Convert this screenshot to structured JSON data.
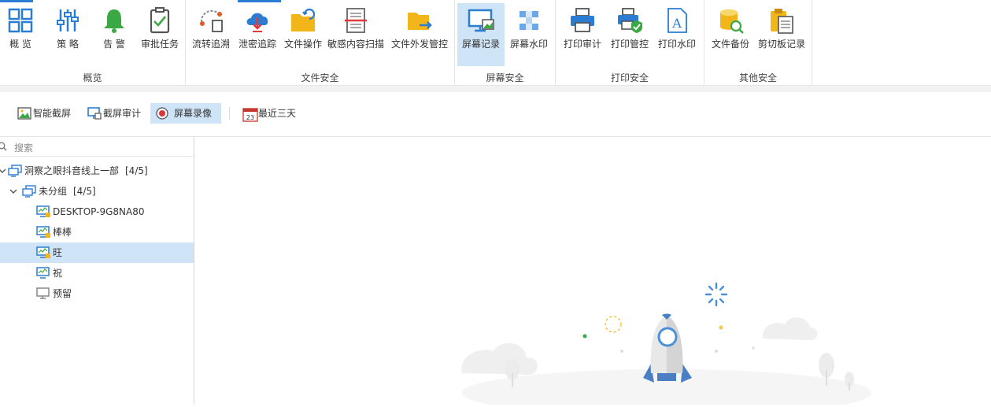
{
  "ribbon": {
    "groups": [
      {
        "label": "概览",
        "items": [
          {
            "label": "概 览",
            "icon": "overview-grid-icon"
          },
          {
            "label": "策 略",
            "icon": "policy-sliders-icon"
          },
          {
            "label": "告 警",
            "icon": "alarm-bell-icon"
          },
          {
            "label": "审批任务",
            "icon": "approval-clipboard-icon"
          }
        ]
      },
      {
        "label": "文件安全",
        "items": [
          {
            "label": "流转追溯",
            "icon": "flow-trace-icon"
          },
          {
            "label": "泄密追踪",
            "icon": "leak-cloud-icon"
          },
          {
            "label": "文件操作",
            "icon": "file-operation-folder-icon"
          },
          {
            "label": "敏感内容扫描",
            "icon": "sensitive-scan-icon"
          },
          {
            "label": "文件外发管控",
            "icon": "outgoing-file-control-icon"
          }
        ]
      },
      {
        "label": "屏幕安全",
        "items": [
          {
            "label": "屏幕记录",
            "icon": "screen-record-icon"
          },
          {
            "label": "屏幕水印",
            "icon": "screen-watermark-icon"
          }
        ]
      },
      {
        "label": "打印安全",
        "items": [
          {
            "label": "打印审计",
            "icon": "print-audit-icon"
          },
          {
            "label": "打印管控",
            "icon": "print-control-icon"
          },
          {
            "label": "打印水印",
            "icon": "print-watermark-icon"
          }
        ]
      },
      {
        "label": "其他安全",
        "items": [
          {
            "label": "文件备份",
            "icon": "file-backup-icon"
          },
          {
            "label": "剪切板记录",
            "icon": "clipboard-record-icon"
          }
        ]
      }
    ]
  },
  "toolbar": {
    "smart_capture": "智能截屏",
    "capture_audit": "截屏审计",
    "screen_video": "屏幕录像",
    "recent_days": "最近三天",
    "calendar_day": "23"
  },
  "sidebar": {
    "search_placeholder": "搜索",
    "root": {
      "label": "洞察之眼抖音线上一部",
      "count": "[4/5]"
    },
    "group": {
      "label": "未分组",
      "count": "[4/5]"
    },
    "devices": [
      {
        "label": "DESKTOP-9G8NA80",
        "status": "online-locked"
      },
      {
        "label": "棒棒",
        "status": "online-locked"
      },
      {
        "label": "旺",
        "status": "online-locked",
        "selected": true
      },
      {
        "label": "祝",
        "status": "online"
      },
      {
        "label": "预留",
        "status": "offline"
      }
    ]
  },
  "colors": {
    "accent": "#2b7cd3",
    "selected_bg": "#cfe4f7",
    "record_red": "#d9363e"
  }
}
